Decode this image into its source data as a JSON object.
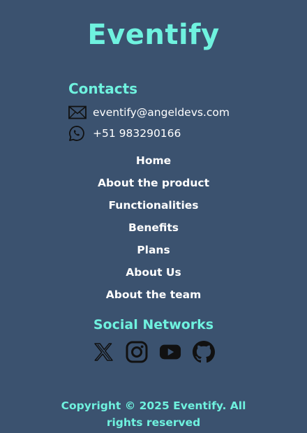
{
  "brand": "Eventify",
  "contacts": {
    "title": "Contacts",
    "email": "eventify@angeldevs.com",
    "phone": "+51 983290166",
    "email_icon": "mail-icon",
    "phone_icon": "whatsapp-icon"
  },
  "nav": {
    "items": [
      "Home",
      "About the product",
      "Functionalities",
      "Benefits",
      "Plans",
      "About Us",
      "About the team"
    ]
  },
  "social": {
    "title": "Social Networks",
    "icons": [
      "x-icon",
      "instagram-icon",
      "youtube-icon",
      "github-icon"
    ]
  },
  "copyright": "Copyright © 2025 Eventify. All rights reserved",
  "colors": {
    "background": "#3b526f",
    "accent": "#6ff2df",
    "text": "#ffffff",
    "icon": "#111111"
  }
}
